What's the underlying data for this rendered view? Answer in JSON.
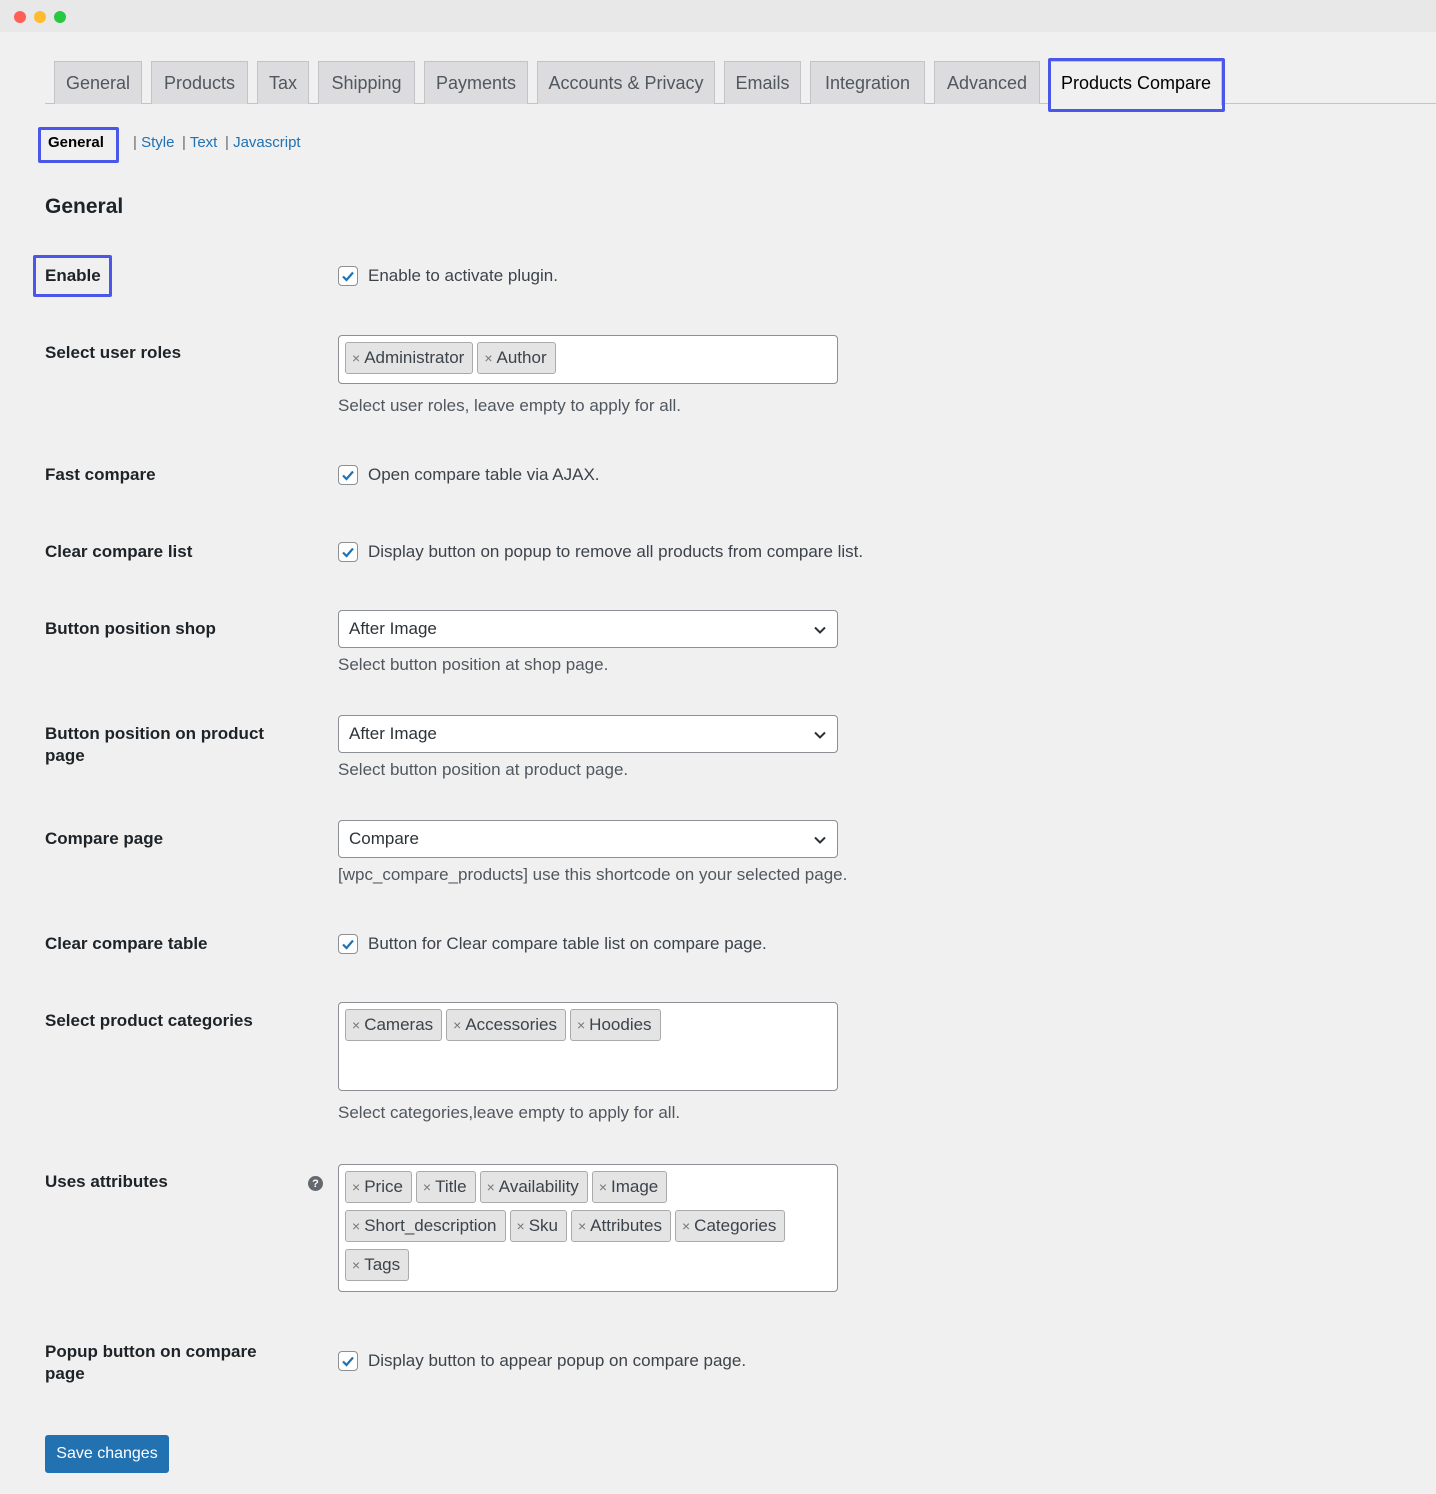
{
  "tabs": [
    {
      "label": "General"
    },
    {
      "label": "Products"
    },
    {
      "label": "Tax"
    },
    {
      "label": "Shipping"
    },
    {
      "label": "Payments"
    },
    {
      "label": "Accounts & Privacy"
    },
    {
      "label": "Emails"
    },
    {
      "label": "Integration"
    },
    {
      "label": "Advanced"
    },
    {
      "label": "Products Compare",
      "active": true
    }
  ],
  "subnav": {
    "current": "General",
    "links": [
      "Style",
      "Text",
      "Javascript"
    ],
    "separator": "|"
  },
  "section_title": "General",
  "fields": {
    "enable": {
      "label": "Enable",
      "checked": true,
      "text": "Enable to activate plugin."
    },
    "user_roles": {
      "label": "Select user roles",
      "values": [
        "Administrator",
        "Author"
      ],
      "desc": "Select user roles, leave empty to apply for all."
    },
    "fast_compare": {
      "label": "Fast compare",
      "checked": true,
      "text": "Open compare table via AJAX."
    },
    "clear_list": {
      "label": "Clear compare list",
      "checked": true,
      "text": "Display button on popup to remove all products from compare list."
    },
    "btn_pos_shop": {
      "label": "Button position shop",
      "value": "After Image",
      "desc": "Select button position at shop page."
    },
    "btn_pos_product": {
      "label": "Button position on product page",
      "value": "After Image",
      "desc": "Select button position at product page."
    },
    "compare_page": {
      "label": "Compare page",
      "value": "Compare",
      "desc": "[wpc_compare_products] use this shortcode on your selected page."
    },
    "clear_table": {
      "label": "Clear compare table",
      "checked": true,
      "text": "Button for Clear compare table list on compare page."
    },
    "categories": {
      "label": "Select product categories",
      "values": [
        "Cameras",
        "Accessories",
        "Hoodies"
      ],
      "desc": "Select categories,leave empty to apply for all."
    },
    "attributes": {
      "label": "Uses attributes",
      "help": "?",
      "values": [
        "Price",
        "Title",
        "Availability",
        "Image",
        "Short_description",
        "Sku",
        "Attributes",
        "Categories",
        "Tags"
      ]
    },
    "popup_button": {
      "label": "Popup button on compare page",
      "checked": true,
      "text": "Display button to appear popup on compare page."
    }
  },
  "chip_remove": "×",
  "save_label": "Save changes",
  "colors": {
    "accent": "#2271b1",
    "highlight": "#4a57e8",
    "background": "#f0f0f1"
  },
  "icons": {
    "checkbox": "check-icon",
    "select": "chevron-down-icon",
    "help": "question-circle-icon"
  }
}
